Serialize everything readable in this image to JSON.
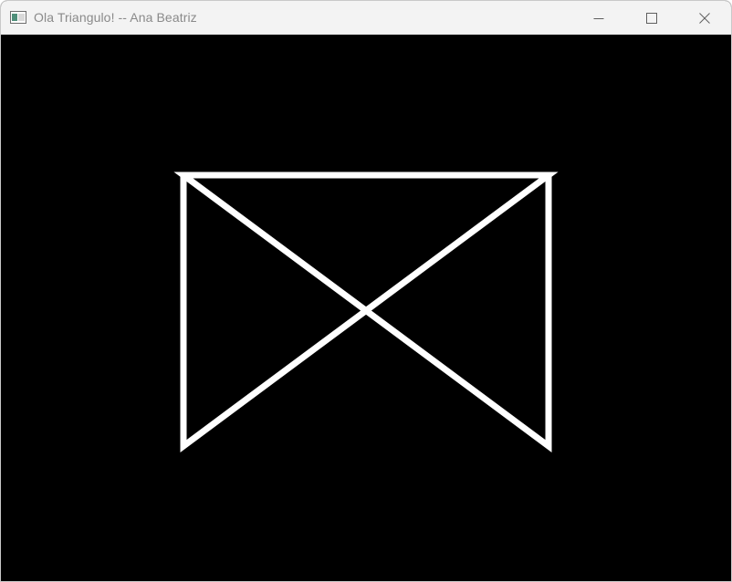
{
  "window": {
    "title": "Ola Triangulo! -- Ana Beatriz",
    "app_icon": "app-window-icon",
    "controls": [
      {
        "name": "minimize-icon"
      },
      {
        "name": "maximize-icon"
      },
      {
        "name": "close-icon"
      }
    ]
  },
  "canvas": {
    "background": "#000000",
    "stroke_color": "#ffffff",
    "shape": "bowtie-triangles"
  }
}
